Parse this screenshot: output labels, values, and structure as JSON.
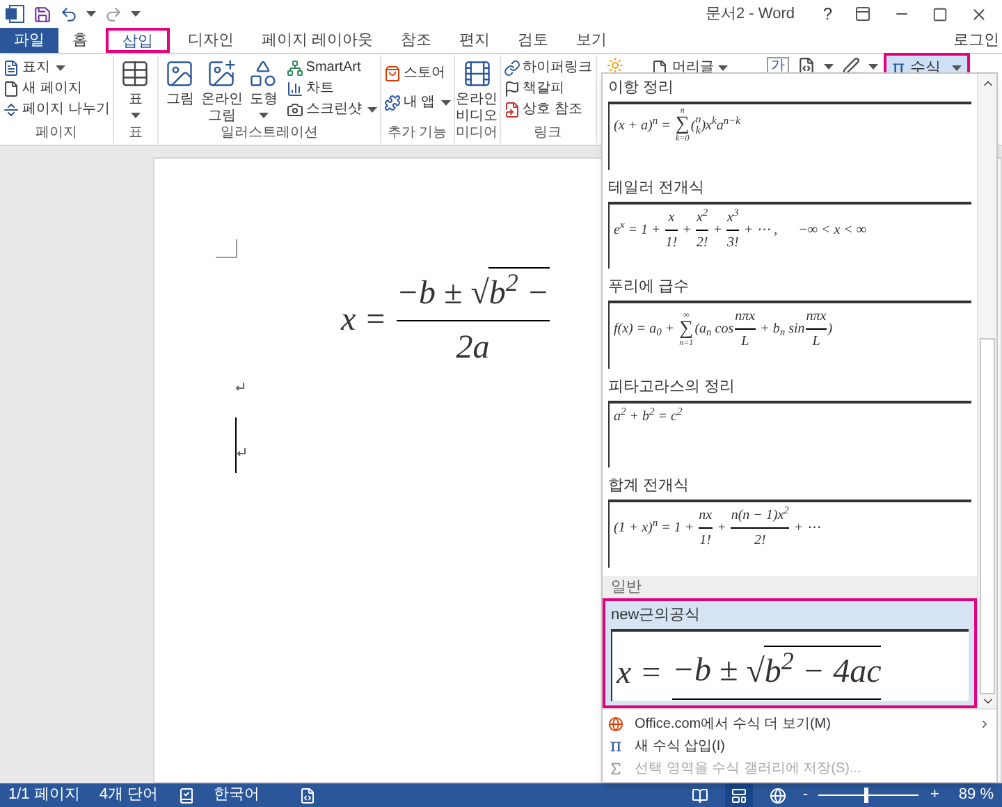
{
  "window": {
    "title": "문서2 - Word",
    "help": "?"
  },
  "tabs": [
    {
      "label": "파일",
      "kind": "file",
      "selected": false
    },
    {
      "label": "홈",
      "kind": "tab",
      "selected": false
    },
    {
      "label": "삽입",
      "kind": "tab",
      "selected": true
    },
    {
      "label": "디자인",
      "kind": "tab",
      "selected": false
    },
    {
      "label": "페이지 레이아웃",
      "kind": "tab",
      "selected": false
    },
    {
      "label": "참조",
      "kind": "tab",
      "selected": false
    },
    {
      "label": "편지",
      "kind": "tab",
      "selected": false
    },
    {
      "label": "검토",
      "kind": "tab",
      "selected": false
    },
    {
      "label": "보기",
      "kind": "tab",
      "selected": false
    }
  ],
  "sign_in": "로그인",
  "ribbon": {
    "groups": [
      {
        "label": "페이지",
        "items": [
          {
            "label": "표지",
            "kind": "small",
            "dropdown": true
          },
          {
            "label": "새 페이지",
            "kind": "small",
            "dropdown": false
          },
          {
            "label": "페이지 나누기",
            "kind": "small",
            "dropdown": false
          }
        ]
      },
      {
        "label": "표",
        "items": [
          {
            "label": "표",
            "kind": "large",
            "dropdown": true
          }
        ]
      },
      {
        "label": "일러스트레이션",
        "items": [
          {
            "label": "그림",
            "kind": "large",
            "dropdown": false
          },
          {
            "label": "온라인 그림",
            "kind": "large",
            "dropdown": false
          },
          {
            "label": "도형",
            "kind": "large",
            "dropdown": true
          },
          {
            "label": "SmartArt",
            "kind": "small",
            "dropdown": false
          },
          {
            "label": "차트",
            "kind": "small",
            "dropdown": false
          },
          {
            "label": "스크린샷",
            "kind": "small",
            "dropdown": true
          }
        ]
      },
      {
        "label": "추가 기능",
        "items": [
          {
            "label": "스토어",
            "kind": "small",
            "dropdown": false
          },
          {
            "label": "내 앱",
            "kind": "small",
            "dropdown": true
          }
        ]
      },
      {
        "label": "미디어",
        "items": [
          {
            "label": "온라인 비디오",
            "kind": "large",
            "dropdown": false
          }
        ]
      },
      {
        "label": "링크",
        "items": [
          {
            "label": "하이퍼링크",
            "kind": "small",
            "dropdown": false
          },
          {
            "label": "책갈피",
            "kind": "small",
            "dropdown": false
          },
          {
            "label": "상호 참조",
            "kind": "small",
            "dropdown": false
          }
        ]
      }
    ],
    "header_button": {
      "label": "머리글",
      "dropdown": true
    },
    "text_box": {
      "label": "가"
    },
    "equation_button": {
      "symbol": "π",
      "label": "수식",
      "pressed": true
    }
  },
  "document": {
    "equation": [
      {
        "kind": "text",
        "s": "x = "
      },
      {
        "kind": "frac",
        "num": [
          {
            "kind": "text",
            "s": "−b ± "
          },
          {
            "kind": "sqrt",
            "symbol": "√",
            "s": "b$^{2}$ −"
          }
        ],
        "den": [
          {
            "kind": "text",
            "s": "2a"
          }
        ]
      }
    ]
  },
  "gallery": {
    "items": [
      {
        "kind": "equation",
        "title": "이항 정리",
        "selected": false,
        "equation": [
          {
            "kind": "text",
            "s": "(x + a)$^{n}$ = "
          },
          {
            "kind": "sum",
            "symbol": "∑",
            "top": "n",
            "bottom": "k=0"
          },
          {
            "kind": "text",
            "s": "("
          },
          {
            "kind": "binom",
            "top": "n",
            "bottom": "k"
          },
          {
            "kind": "text",
            "s": ")x$^{k}$a$^{n−k}$"
          }
        ]
      },
      {
        "kind": "equation",
        "title": "테일러 전개식",
        "selected": false,
        "equation": [
          {
            "kind": "text",
            "s": "e$^{x}$ = 1 + "
          },
          {
            "kind": "frac",
            "num": [
              {
                "kind": "text",
                "s": "x"
              }
            ],
            "den": [
              {
                "kind": "text",
                "s": "1!"
              }
            ]
          },
          {
            "kind": "text",
            "s": " + "
          },
          {
            "kind": "frac",
            "num": [
              {
                "kind": "text",
                "s": "x$^{2}$"
              }
            ],
            "den": [
              {
                "kind": "text",
                "s": "2!"
              }
            ]
          },
          {
            "kind": "text",
            "s": " + "
          },
          {
            "kind": "frac",
            "num": [
              {
                "kind": "text",
                "s": "x$^{3}$"
              }
            ],
            "den": [
              {
                "kind": "text",
                "s": "3!"
              }
            ]
          },
          {
            "kind": "text",
            "s": " + ⋯ ,      −∞ < x < ∞"
          }
        ]
      },
      {
        "kind": "equation",
        "title": "푸리에 급수",
        "selected": false,
        "equation": [
          {
            "kind": "text",
            "s": "f(x) = a$_{0}$ + "
          },
          {
            "kind": "sum",
            "symbol": "∑",
            "top": "∞",
            "bottom": "n=1"
          },
          {
            "kind": "text",
            "s": "(a$_{n}$ cos"
          },
          {
            "kind": "frac",
            "num": [
              {
                "kind": "text",
                "s": "nπx"
              }
            ],
            "den": [
              {
                "kind": "text",
                "s": "L"
              }
            ]
          },
          {
            "kind": "text",
            "s": " + b$_{n}$ sin"
          },
          {
            "kind": "frac",
            "num": [
              {
                "kind": "text",
                "s": "nπx"
              }
            ],
            "den": [
              {
                "kind": "text",
                "s": "L"
              }
            ]
          },
          {
            "kind": "text",
            "s": ")"
          }
        ]
      },
      {
        "kind": "equation",
        "title": "피타고라스의 정리",
        "selected": false,
        "equation": [
          {
            "kind": "text",
            "s": "a$^{2}$ + b$^{2}$ = c$^{2}$"
          }
        ]
      },
      {
        "kind": "equation",
        "title": "합계 전개식",
        "selected": false,
        "equation": [
          {
            "kind": "text",
            "s": "(1 + x)$^{n}$ = 1 + "
          },
          {
            "kind": "frac",
            "num": [
              {
                "kind": "text",
                "s": "nx"
              }
            ],
            "den": [
              {
                "kind": "text",
                "s": "1!"
              }
            ]
          },
          {
            "kind": "text",
            "s": " + "
          },
          {
            "kind": "frac",
            "num": [
              {
                "kind": "text",
                "s": "n(n − 1)x$^{2}$"
              }
            ],
            "den": [
              {
                "kind": "text",
                "s": "2!"
              }
            ]
          },
          {
            "kind": "text",
            "s": " + ⋯"
          }
        ]
      },
      {
        "kind": "category",
        "title": "일반"
      },
      {
        "kind": "equation",
        "title": "new근의공식",
        "selected": true,
        "equation": [
          {
            "kind": "text",
            "s": "x = "
          },
          {
            "kind": "frac",
            "num": [
              {
                "kind": "text",
                "s": "−b ± "
              },
              {
                "kind": "sqrt",
                "symbol": "√",
                "s": "b$^{2}$ − 4ac"
              }
            ]
          }
        ]
      }
    ],
    "menu": [
      {
        "label": "Office.com에서 수식 더 보기(M)",
        "disabled": false,
        "submenu": true
      },
      {
        "label": "새 수식 삽입(I)",
        "symbol": "π",
        "disabled": false,
        "submenu": false
      },
      {
        "label": "선택 영역을 수식 갤러리에 저장(S)...",
        "disabled": true,
        "submenu": false
      }
    ]
  },
  "status_bar": {
    "page": "1/1 페이지",
    "words": "4개 단어",
    "language": "한국어",
    "views": [
      {
        "kind": "read",
        "selected": false
      },
      {
        "kind": "print",
        "selected": true
      },
      {
        "kind": "web",
        "selected": false
      }
    ],
    "zoom_out": "-",
    "zoom_in": "+",
    "zoom": {
      "level": 0.45
    },
    "zoom_reading": "89 %"
  }
}
